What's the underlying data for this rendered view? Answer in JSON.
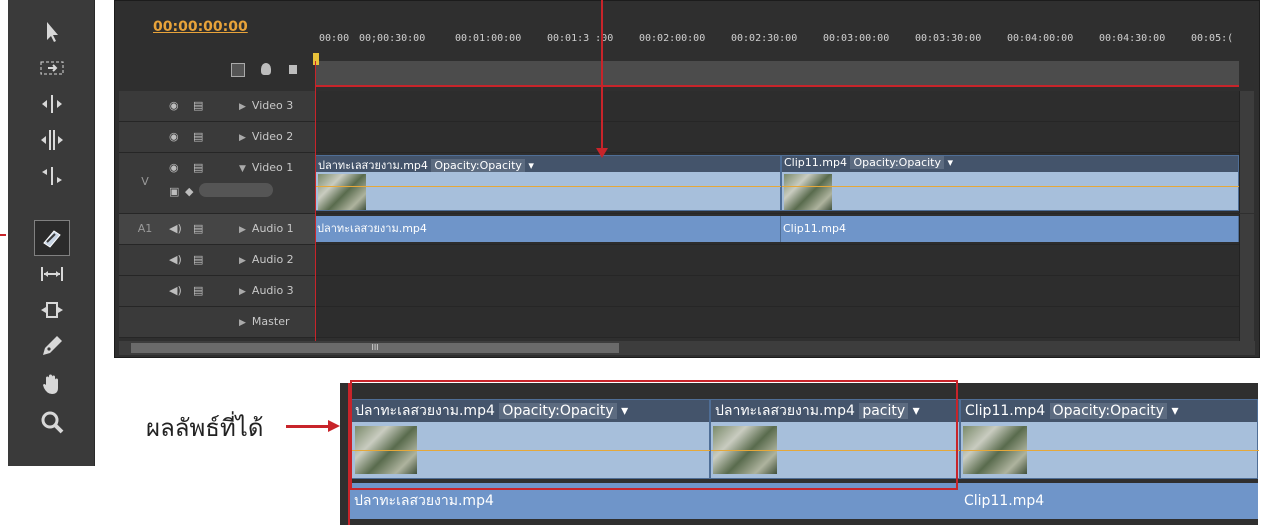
{
  "toolbar": {
    "tools": [
      {
        "name": "selection-tool-icon"
      },
      {
        "name": "track-select-tool-icon"
      },
      {
        "name": "ripple-edit-tool-icon"
      },
      {
        "name": "rolling-edit-tool-icon"
      },
      {
        "name": "rate-stretch-tool-icon"
      },
      {
        "name": "razor-tool-icon",
        "selected": true
      },
      {
        "name": "slip-tool-icon"
      },
      {
        "name": "slide-tool-icon"
      },
      {
        "name": "pen-tool-icon"
      },
      {
        "name": "hand-tool-icon"
      },
      {
        "name": "zoom-tool-icon"
      }
    ]
  },
  "timeline": {
    "timecode": "00:00:00:00",
    "ruler": [
      "00:00",
      "00;00:30:00",
      "00:01:00:00",
      "00:01:3 :00",
      "00:02:00:00",
      "00:02:30:00",
      "00:03:00:00",
      "00:03:30:00",
      "00:04:00:00",
      "00:04:30:00",
      "00:05:("
    ],
    "tracks": {
      "video3": "Video 3",
      "video2": "Video 2",
      "video1": "Video 1",
      "audio1": "Audio 1",
      "audio2": "Audio 2",
      "audio3": "Audio 3",
      "master": "Master",
      "v_label": "V",
      "a1_label": "A1"
    },
    "clips": {
      "v1_clip1_name": "ปลาทะเลสวยงาม.mp4",
      "v1_clip1_effect": "Opacity:Opacity",
      "v1_clip2_name": "Clip11.mp4",
      "v1_clip2_effect": "Opacity:Opacity",
      "a1_clip1_name": "ปลาทะเลสวยงาม.mp4",
      "a1_clip2_name": "Clip11.mp4"
    },
    "scroll_mark": "III"
  },
  "caption": {
    "text": "ผลลัพธ์ที่ได้"
  },
  "result": {
    "clip1_name": "ปลาทะเลสวยงาม.mp4",
    "clip1_effect": "Opacity:Opacity",
    "clip2_name": "ปลาทะเลสวยงาม.mp4",
    "clip2_effect": "pacity",
    "clip3_name": "Clip11.mp4",
    "clip3_effect": "Opacity:Opacity",
    "audio1_name": "ปลาทะเลสวยงาม.mp4",
    "audio2_name": "Clip11.mp4"
  },
  "colors": {
    "annotation_red": "#c8242a",
    "timecode_orange": "#e8a33a",
    "video_clip": "#a7bfdb",
    "audio_clip": "#6f95c9"
  }
}
